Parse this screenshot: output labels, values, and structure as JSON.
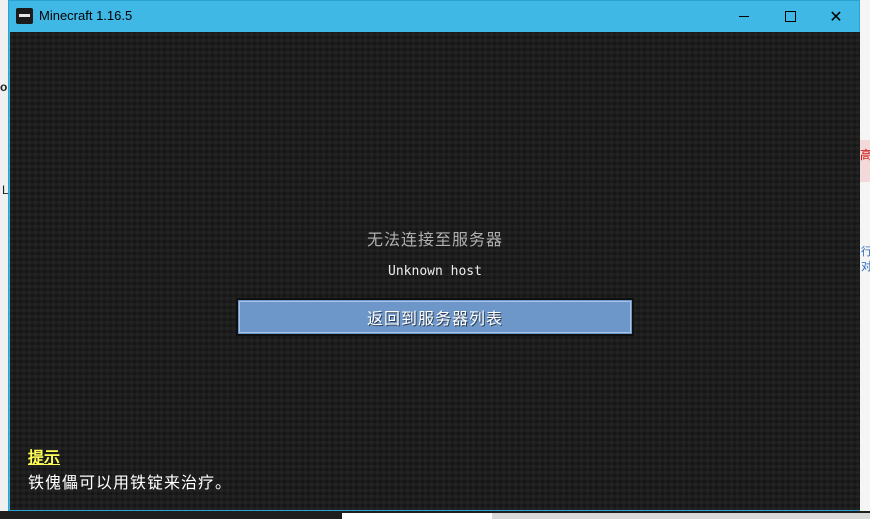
{
  "window": {
    "title": "Minecraft 1.16.5",
    "controls": {
      "minimize": "minimize",
      "maximize": "maximize",
      "close": "close"
    }
  },
  "background_app": {
    "left_glyph_1": "o",
    "left_glyph_2": "L",
    "right_glyph_red": "高",
    "right_glyph_blue_1": "行",
    "right_glyph_blue_2": "对"
  },
  "screen": {
    "error_title": "无法连接至服务器",
    "error_detail": "Unknown host",
    "back_button_label": "返回到服务器列表"
  },
  "tip": {
    "title": "提示",
    "text": "铁傀儡可以用铁锭来治疗。"
  },
  "colors": {
    "titlebar": "#3fb8e6",
    "button": "#6d97c9",
    "tip_title": "#ffff55"
  }
}
